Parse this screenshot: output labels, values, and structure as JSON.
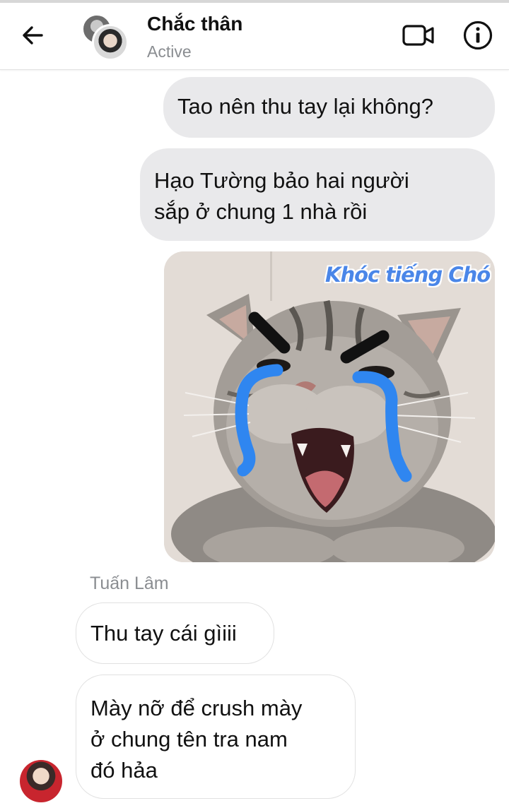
{
  "header": {
    "contact_name": "Chắc thân",
    "status": "Active",
    "icons": [
      "back-arrow-icon",
      "video-call-icon",
      "info-icon"
    ]
  },
  "messages": {
    "outgoing": [
      {
        "text": "Tao nên thu tay lại không?"
      },
      {
        "text_lines": [
          "Hạo Tường bảo hai người",
          "sắp ở chung 1 nhà rồi"
        ]
      }
    ],
    "sticker": {
      "caption": "Khóc tiếng Chó"
    },
    "sender_name": "Tuấn Lâm",
    "incoming": [
      {
        "text": "Thu tay cái gìiii"
      },
      {
        "text_lines": [
          "Mày nỡ để crush mày",
          "ở chung tên tra nam",
          "đó hảa"
        ]
      }
    ]
  },
  "colors": {
    "outgoing_bubble": "#e9e9eb",
    "incoming_bubble": "#ffffff",
    "secondary_text": "#8a8d91",
    "sticker_caption": "#4a86e8",
    "tears": "#2f86f0"
  }
}
